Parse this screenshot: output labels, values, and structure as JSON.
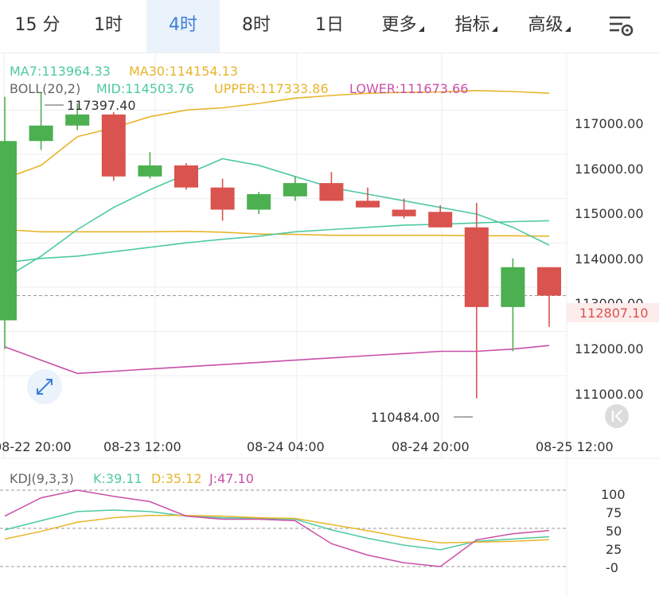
{
  "tabs": [
    {
      "label": "15 分",
      "active": false,
      "dropdown": false
    },
    {
      "label": "1时",
      "active": false,
      "dropdown": false
    },
    {
      "label": "4时",
      "active": true,
      "dropdown": false
    },
    {
      "label": "8时",
      "active": false,
      "dropdown": false
    },
    {
      "label": "1日",
      "active": false,
      "dropdown": false
    },
    {
      "label": "更多",
      "active": false,
      "dropdown": true
    },
    {
      "label": "指标",
      "active": false,
      "dropdown": true
    },
    {
      "label": "高级",
      "active": false,
      "dropdown": true
    }
  ],
  "settings_icon": "chart-settings-icon",
  "colors": {
    "up": "#4caf50",
    "down": "#d9534f",
    "ma7": "#4ec9a4",
    "ma30": "#e8b52a",
    "boll_lower": "#c94fa8",
    "grid": "#eeeeee",
    "accent": "#3e7fd6"
  },
  "legend": {
    "ma7": "MA7:113964.33",
    "ma30": "MA30:114154.13",
    "boll": "BOLL(20,2)",
    "mid": "MID:114503.76",
    "upper": "UPPER:117333.86",
    "lower": "LOWER:111673.66",
    "kdj": "KDJ(9,3,3)",
    "k": "K:39.11",
    "d": "D:35.12",
    "j": "J:47.10"
  },
  "price_axis": {
    "labels": [
      "117000.00",
      "116000.00",
      "115000.00",
      "114000.00",
      "113000.00",
      "112000.00",
      "111000.00"
    ]
  },
  "current_price": "112807.10",
  "high_label": "117397.40",
  "low_label": "110484.00",
  "time_axis": {
    "labels": [
      "08-22 20:00",
      "08-23 12:00",
      "08-24 04:00",
      "08-24 20:00",
      "08-25 12:00"
    ]
  },
  "kdj_axis": {
    "labels": [
      "100",
      "75",
      "50",
      "25",
      "-0"
    ]
  },
  "chart_data": {
    "type": "candlestick",
    "ylim": [
      110300,
      118300
    ],
    "candles": [
      {
        "o": 112250,
        "h": 117300,
        "l": 111600,
        "c": 116300
      },
      {
        "o": 116300,
        "h": 117397.4,
        "l": 116100,
        "c": 116650
      },
      {
        "o": 116650,
        "h": 117150,
        "l": 116550,
        "c": 116900
      },
      {
        "o": 116900,
        "h": 116950,
        "l": 115400,
        "c": 115500
      },
      {
        "o": 115500,
        "h": 116050,
        "l": 115450,
        "c": 115750
      },
      {
        "o": 115750,
        "h": 115800,
        "l": 115200,
        "c": 115250
      },
      {
        "o": 115250,
        "h": 115450,
        "l": 114500,
        "c": 114750
      },
      {
        "o": 114750,
        "h": 115150,
        "l": 114650,
        "c": 115100
      },
      {
        "o": 115050,
        "h": 115500,
        "l": 114950,
        "c": 115350
      },
      {
        "o": 115350,
        "h": 115600,
        "l": 114950,
        "c": 114950
      },
      {
        "o": 114950,
        "h": 115250,
        "l": 114800,
        "c": 114800
      },
      {
        "o": 114750,
        "h": 115000,
        "l": 114550,
        "c": 114600
      },
      {
        "o": 114700,
        "h": 114850,
        "l": 114350,
        "c": 114350
      },
      {
        "o": 114350,
        "h": 114900,
        "l": 110484,
        "c": 112550
      },
      {
        "o": 112550,
        "h": 113650,
        "l": 111550,
        "c": 113450
      },
      {
        "o": 113450,
        "h": 113450,
        "l": 112100,
        "c": 112807.1
      }
    ],
    "ma7": [
      113200,
      113700,
      114300,
      114800,
      115200,
      115550,
      115900,
      115750,
      115500,
      115250,
      115100,
      114950,
      114800,
      114650,
      114350,
      113950
    ],
    "ma30": [
      114300,
      114250,
      114250,
      114250,
      114250,
      114260,
      114240,
      114200,
      114190,
      114170,
      114170,
      114170,
      114170,
      114160,
      114160,
      114150
    ],
    "boll_upper": [
      115450,
      115750,
      116400,
      116600,
      116850,
      117000,
      117050,
      117150,
      117270,
      117330,
      117380,
      117400,
      117410,
      117440,
      117420,
      117380
    ],
    "boll_mid": [
      113550,
      113650,
      113700,
      113800,
      113900,
      114000,
      114080,
      114150,
      114250,
      114300,
      114350,
      114400,
      114420,
      114450,
      114480,
      114500
    ],
    "boll_lower": [
      111650,
      111350,
      111050,
      111100,
      111150,
      111200,
      111250,
      111300,
      111350,
      111400,
      111450,
      111500,
      111550,
      111550,
      111600,
      111680
    ],
    "kdj": {
      "k": [
        48,
        60,
        72,
        74,
        72,
        66,
        64,
        63,
        62,
        48,
        37,
        28,
        22,
        33,
        36,
        39.11
      ],
      "d": [
        36,
        46,
        58,
        64,
        67,
        67,
        66,
        64,
        63,
        55,
        47,
        38,
        31,
        32,
        33,
        35.12
      ],
      "j": [
        66,
        90,
        100,
        92,
        85,
        66,
        62,
        62,
        60,
        30,
        15,
        5,
        0,
        35,
        43,
        47.1
      ]
    }
  }
}
